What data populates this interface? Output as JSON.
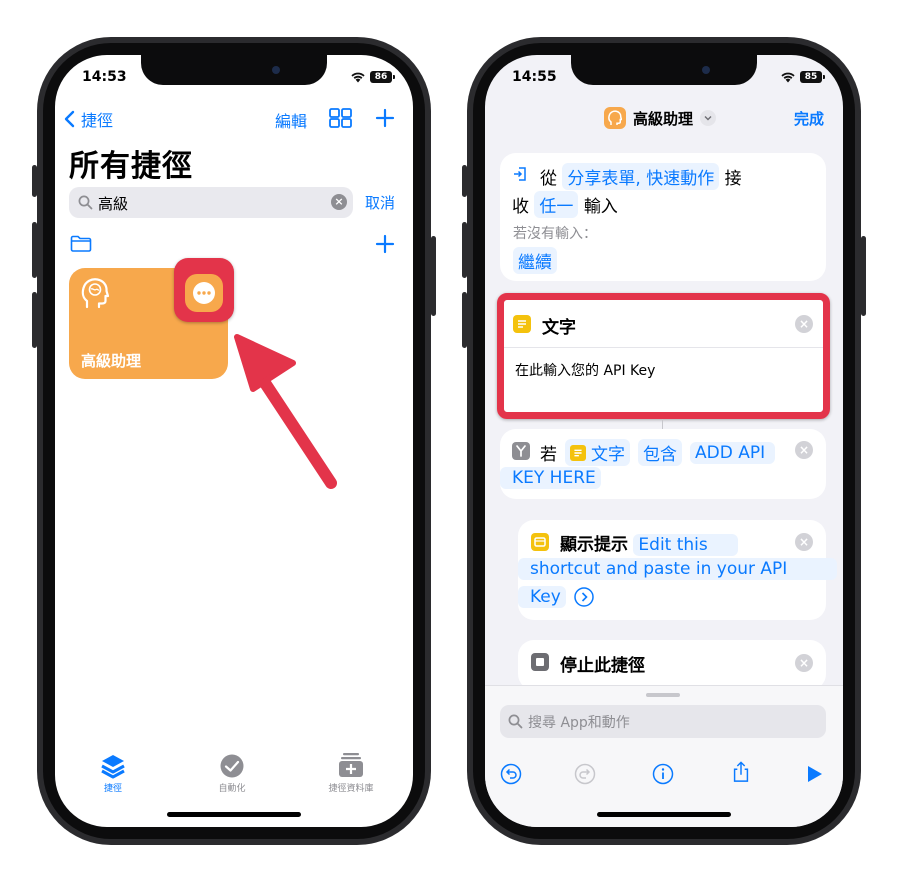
{
  "left": {
    "status": {
      "time": "14:53",
      "battery": "86"
    },
    "nav": {
      "back_label": "捷徑",
      "edit_label": "編輯"
    },
    "title": "所有捷徑",
    "search": {
      "value": "高級",
      "cancel_label": "取消"
    },
    "shortcut": {
      "name": "高級助理"
    },
    "tabs": [
      {
        "label": "捷徑",
        "active": true
      },
      {
        "label": "自動化",
        "active": false
      },
      {
        "label": "捷徑資料庫",
        "active": false
      }
    ]
  },
  "right": {
    "status": {
      "time": "14:55",
      "battery": "85"
    },
    "nav": {
      "title": "高級助理",
      "done_label": "完成"
    },
    "receive": {
      "prefix": "從",
      "sources": "分享表單, 快速動作",
      "mid": "接",
      "line2_prefix": "收",
      "input_type": "任一",
      "line2_suffix": "輸入",
      "no_input_label": "若沒有輸入：",
      "no_input_action": "繼續"
    },
    "text_action": {
      "title": "文字",
      "content": "在此輸入您的 API Key"
    },
    "if_action": {
      "label": "若",
      "variable": "文字",
      "condition": "包含",
      "value_line1": "ADD API",
      "value_line2": "KEY HERE"
    },
    "alert_action": {
      "label": "顯示提示",
      "line1": "Edit this",
      "line2": "shortcut and paste in your API",
      "line3": "Key"
    },
    "stop_action": {
      "label": "停止此捷徑"
    },
    "search_placeholder": "搜尋 App和動作"
  },
  "colors": {
    "accent": "#0a7aff",
    "tile": "#f7a84c",
    "highlight": "#e3344a",
    "text_icon": "#f4c20d"
  }
}
